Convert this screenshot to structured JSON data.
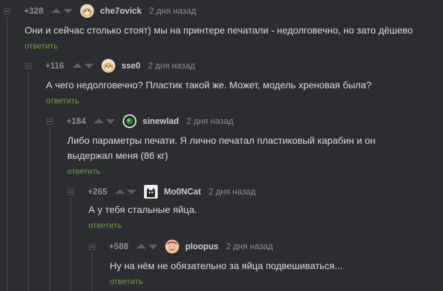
{
  "comments": [
    {
      "rating": "+328",
      "username": "che7ovick",
      "time": "2 дня назад",
      "text": "Они и сейчас столько стоят) мы на принтере печатали - недолговечно, но зато дёшево",
      "reply": "ответить",
      "avatar_icon": "cat-avatar-icon"
    },
    {
      "rating": "+116",
      "username": "sse0",
      "time": "2 дня назад",
      "text": "А чего недолговечно? Пластик такой же. Может, модель хреновая была?",
      "reply": "ответить",
      "avatar_icon": "doge-avatar-icon"
    },
    {
      "rating": "+184",
      "username": "sinewlad",
      "time": "2 дня назад",
      "text_line1": "Либо параметры печати. Я лично печатал пластиковый карабин и он",
      "text_line2": "выдержал меня (86 кг)",
      "reply": "ответить",
      "avatar_icon": "green-orb-avatar-icon"
    },
    {
      "rating": "+265",
      "username": "Mo0NCat",
      "time": "2 дня назад",
      "text": "А у тебя стальные яйца.",
      "reply": "ответить",
      "avatar_icon": "cat-bw-avatar-icon"
    },
    {
      "rating": "+588",
      "username": "ploopus",
      "time": "2 дня назад",
      "text": "Ну на нём не обязательно за яйца подвешиваться...",
      "reply": "ответить",
      "avatar_icon": "cartoon-avatar-icon"
    }
  ],
  "colors": {
    "background": "#2b2d30",
    "text": "#dcdde0",
    "username": "#c9cbce",
    "muted": "#8b8d91",
    "reply_link": "#6da043",
    "thread_line": "#46484c"
  }
}
